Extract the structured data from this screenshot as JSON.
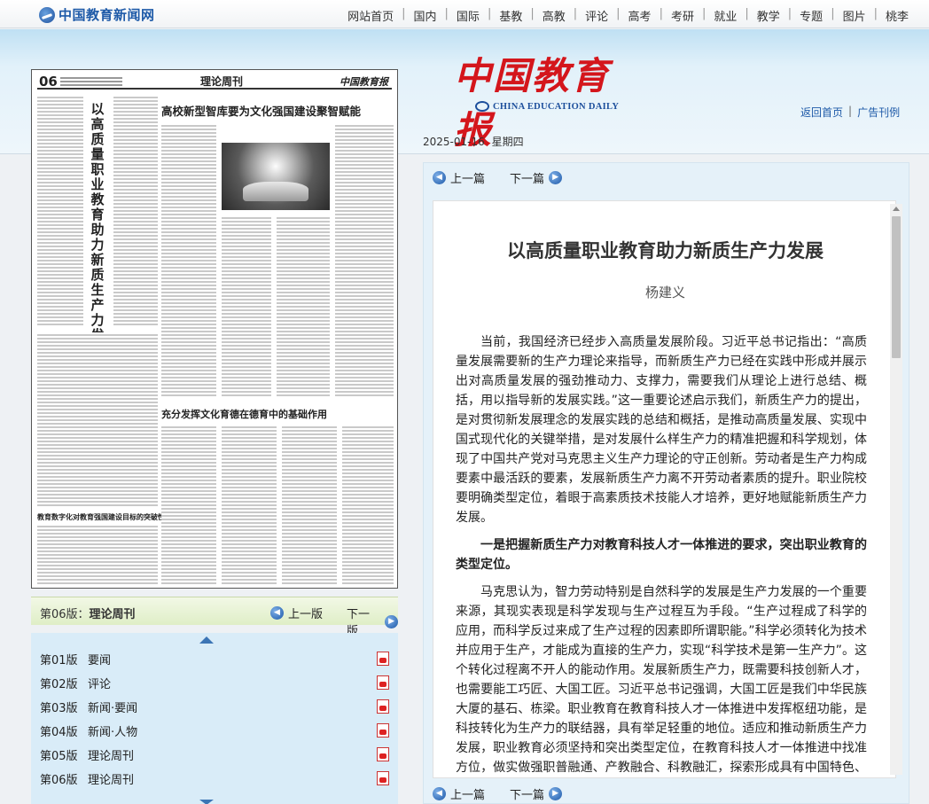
{
  "site": {
    "logo_text": "中国教育新闻网"
  },
  "nav": {
    "items": [
      "网站首页",
      "国内",
      "国际",
      "基教",
      "高教",
      "评论",
      "高考",
      "考研",
      "就业",
      "教学",
      "专题",
      "图片",
      "桃李"
    ]
  },
  "masthead": {
    "cn": "中国教育报",
    "en": "CHINA EDUCATION DAILY"
  },
  "toplinks": {
    "home": "返回首页",
    "pdf": "广告刊例"
  },
  "dateline": {
    "date": "2025-01-16",
    "weekday": "星期四"
  },
  "paper": {
    "page_no": "06",
    "section": "理论周刊",
    "brand": "中国教育报",
    "vertical_title": "以高质量职业教育助力新质生产力发展",
    "headline_1": "高校新型智库要为文化强国建设聚智赋能",
    "headline_2": "充分发挥文化育德在德育中的基础作用",
    "headline_3": "教育数字化对教育强国建设目标的突破性意义"
  },
  "pagebar": {
    "current_prefix": "第06版：",
    "current_name": "理论周刊",
    "prev": "上一版",
    "next": "下一版"
  },
  "pages": [
    {
      "num": "第01版",
      "name": "要闻"
    },
    {
      "num": "第02版",
      "name": "评论"
    },
    {
      "num": "第03版",
      "name": "新闻·要闻"
    },
    {
      "num": "第04版",
      "name": "新闻·人物"
    },
    {
      "num": "第05版",
      "name": "理论周刊"
    },
    {
      "num": "第06版",
      "name": "理论周刊"
    }
  ],
  "article_nav": {
    "prev": "上一篇",
    "next": "下一篇"
  },
  "article": {
    "title": "以高质量职业教育助力新质生产力发展",
    "author": "杨建义",
    "paragraphs": [
      "当前，我国经济已经步入高质量发展阶段。习近平总书记指出：“高质量发展需要新的生产力理论来指导，而新质生产力已经在实践中形成并展示出对高质量发展的强劲推动力、支撑力，需要我们从理论上进行总结、概括，用以指导新的发展实践。”这一重要论述启示我们，新质生产力的提出，是对贯彻新发展理念的发展实践的总结和概括，是推动高质量发展、实现中国式现代化的关键举措，是对发展什么样生产力的精准把握和科学规划，体现了中国共产党对马克思主义生产力理论的守正创新。劳动者是生产力构成要素中最活跃的要素，发展新质生产力离不开劳动者素质的提升。职业院校要明确类型定位，着眼于高素质技术技能人才培养，更好地赋能新质生产力发展。",
      "一是把握新质生产力对教育科技人才一体推进的要求，突出职业教育的类型定位。",
      "马克思认为，智力劳动特别是自然科学的发展是生产力发展的一个重要来源，其现实表现是科学发现与生产过程互为手段。“生产过程成了科学的应用，而科学反过来成了生产过程的因素即所谓职能。”科学必须转化为技术并应用于生产，才能成为直接的生产力，实现“科学技术是第一生产力”。这个转化过程离不开人的能动作用。发展新质生产力，既需要科技创新人才，也需要能工巧匠、大国工匠。习近平总书记强调，大国工匠是我们中华民族大厦的基石、栋梁。职业教育在教育科技人才一体推进中发挥枢纽功能，是科技转化为生产力的联结器，具有举足轻重的地位。适应和推动新质生产力发展，职业教育必须坚持和突出类型定位，在教育科技人才一体推进中找准方位，做实做强职普融通、产教融合、科教融汇，探索形成具有中国特色、世界水平的工程师、高素质技能人才培养体"
    ]
  }
}
